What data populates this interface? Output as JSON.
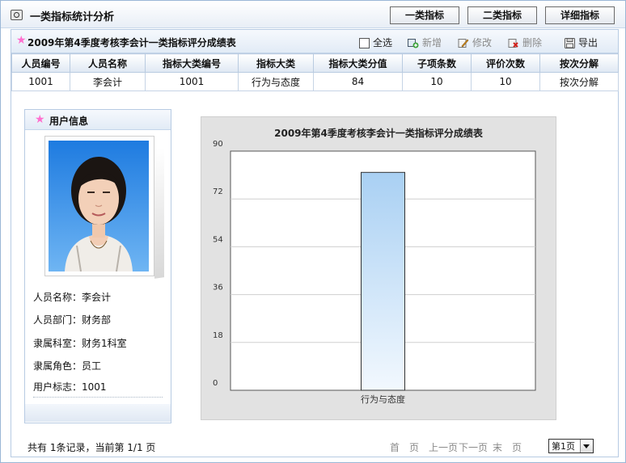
{
  "window": {
    "title": "一类指标统计分析",
    "buttons": [
      "一类指标",
      "二类指标",
      "详细指标"
    ]
  },
  "panel": {
    "title": "2009年第4季度考核李会计一类指标评分成绩表",
    "toolbar": {
      "select_all": "全选",
      "add": "新增",
      "edit": "修改",
      "delete": "删除",
      "export": "导出"
    }
  },
  "table": {
    "columns": [
      "人员编号",
      "人员名称",
      "指标大类编号",
      "指标大类",
      "指标大类分值",
      "子项条数",
      "评价次数",
      "按次分解"
    ],
    "rows": [
      [
        "1001",
        "李会计",
        "1001",
        "行为与态度",
        "84",
        "10",
        "10",
        "按次分解"
      ]
    ]
  },
  "user_info": {
    "title": "用户信息",
    "fields": [
      {
        "label": "人员名称：",
        "value": "李会计"
      },
      {
        "label": "人员部门：",
        "value": "财务部"
      },
      {
        "label": "隶属科室：",
        "value": "财务1科室"
      },
      {
        "label": "隶属角色：",
        "value": "员工"
      },
      {
        "label": "用户标志：",
        "value": "1001"
      }
    ]
  },
  "chart_data": {
    "type": "bar",
    "title": "2009年第4季度考核李会计一类指标评分成绩表",
    "categories": [
      "行为与态度"
    ],
    "values": [
      82
    ],
    "ylim": [
      0,
      90
    ],
    "yticks": [
      0,
      18,
      36,
      54,
      72,
      90
    ],
    "grid": true,
    "bar_color_top": "#a9d0f3",
    "bar_color_bottom": "#f2f8fe"
  },
  "pager": {
    "summary": "共有 1条记录，当前第 1/1 页",
    "first": "首　页",
    "prev": "上一页",
    "next": "下一页",
    "last": "末　页",
    "page_select": "第1页"
  }
}
